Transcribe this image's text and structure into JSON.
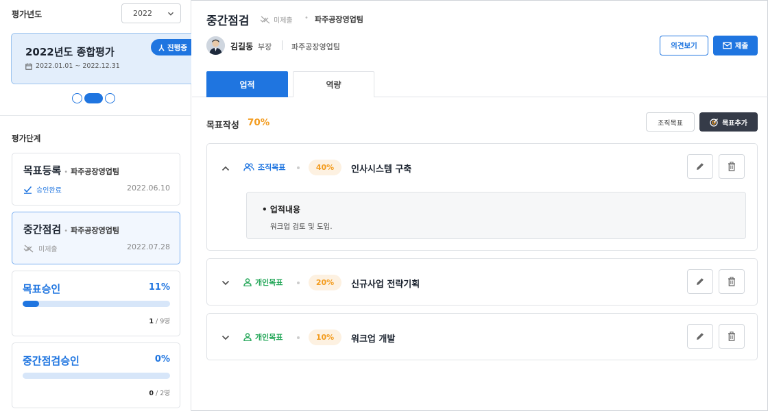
{
  "sidebar": {
    "year_label": "평가년도",
    "year_value": "2022",
    "eval_card": {
      "title": "2022년도 종합평가",
      "period": "2022.01.01 ~ 2022.12.31",
      "badge": "진행중"
    },
    "carousel": {
      "pages": 3,
      "active": 2
    },
    "stage_label": "평가단계",
    "stages": [
      {
        "name": "목표등록",
        "team": "파주공장영업팀",
        "status": "승인완료",
        "date": "2022.06.10"
      },
      {
        "name": "중간점검",
        "team": "파주공장영업팀",
        "status": "미제출",
        "date": "2022.07.28"
      }
    ],
    "progress": [
      {
        "name": "목표승인",
        "percent": "11%",
        "fraction": 0.11,
        "done": "1",
        "total": " / 9명"
      },
      {
        "name": "중간점검승인",
        "percent": "0%",
        "fraction": 0.0,
        "done": "0",
        "total": " / 2명"
      }
    ]
  },
  "header": {
    "title": "중간점검",
    "status": "미제출",
    "separator": "•",
    "team": "파주공장영업팀",
    "user_name": "김길동",
    "user_rank": "부장",
    "user_team": "파주공장영업팀",
    "opinion_button": "의견보기",
    "submit_button": "제출"
  },
  "tabs": [
    "업적",
    "역량"
  ],
  "goals_header": {
    "label": "목표작성",
    "percent": "70%",
    "org_button": "조직목표",
    "add_button": "목표추가"
  },
  "goals": [
    {
      "type": "조직목표",
      "weight": "40%",
      "title": "인사시스템 구축",
      "expanded": true,
      "detail_title": "업적내용",
      "detail_body": "워크업 검토 및 도입."
    },
    {
      "type": "개인목표",
      "weight": "20%",
      "title": "신규사업 전략기획",
      "expanded": false
    },
    {
      "type": "개인목표",
      "weight": "10%",
      "title": "워크업 개발",
      "expanded": false
    }
  ],
  "colors": {
    "primary": "#1f75e0",
    "accent_orange": "#f39c1f",
    "green": "#27a85b",
    "dark_button": "#353b48"
  }
}
